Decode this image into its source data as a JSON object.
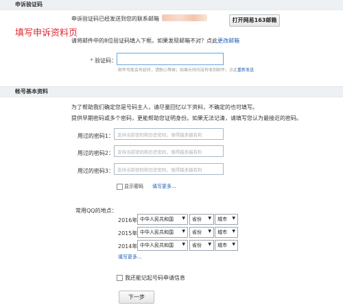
{
  "verify_section": {
    "title": "申诉验证码",
    "sent_text": "申诉验证码已经发送到您的联系邮箱",
    "open_button": "打开网易163邮箱",
    "instruction": "请将邮件中的8位验证码填入下框。如果发现邮箱不对？点此",
    "change_email_link": "更改邮箱",
    "code_label": "验证码：",
    "code_hint": "邮件可能会有延时，请耐心等候；如果长时间没有收到邮件，点此",
    "resend_link": "重新发送"
  },
  "overlay_caption": "填写申诉资料页",
  "account_section": {
    "title": "帐号基本资料",
    "intro_line1": "为了帮助我们确定您是号码主人，请尽量回忆以下资料，不确定的也可填写。",
    "intro_line2": "提供早期密码或多个密码，更能帮助您证明身份。如果无法记清，请填写您认为最接近的密码。",
    "passwords": [
      {
        "label": "用过的密码1：",
        "placeholder": "支持当前密码和历史密码，填得越多越有利"
      },
      {
        "label": "用过的密码2：",
        "placeholder": "支持当前密码和历史密码，填得越多越有利"
      },
      {
        "label": "用过的密码3：",
        "placeholder": "支持当前密码和历史密码，填得越多越有利"
      }
    ],
    "show_password": "显示密码",
    "more_passwords_link": "填写更多...",
    "location_label": "常用QQ的地点：",
    "locations": [
      {
        "year": "2016年",
        "country": "中华人民共和国",
        "province": "省份",
        "city": "城市"
      },
      {
        "year": "2015年",
        "country": "中华人民共和国",
        "province": "省份",
        "city": "城市"
      },
      {
        "year": "2014年",
        "country": "中华人民共和国",
        "province": "省份",
        "city": "城市"
      }
    ],
    "more_locations_link": "填写更多...",
    "remember_info": "我还能记起号码申请信息",
    "next_button": "下一步"
  },
  "colors": {
    "accent_red": "#e0252d",
    "link_blue": "#1a5eb1",
    "input_focus": "#62a5df"
  }
}
